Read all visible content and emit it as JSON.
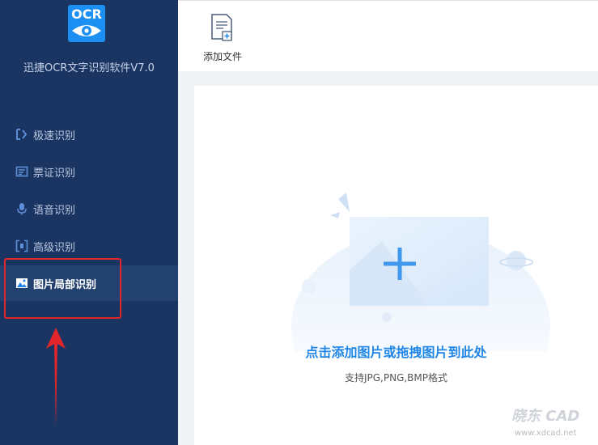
{
  "app": {
    "logo_text": "OCR",
    "title": "迅捷OCR文字识别软件V7.0"
  },
  "sidebar": {
    "items": [
      {
        "label": "极速识别",
        "icon": "fast-scan-icon"
      },
      {
        "label": "票证识别",
        "icon": "ticket-icon"
      },
      {
        "label": "语音识别",
        "icon": "microphone-icon"
      },
      {
        "label": "高级识别",
        "icon": "advanced-scan-icon"
      },
      {
        "label": "图片局部识别",
        "icon": "image-crop-icon",
        "active": true
      }
    ]
  },
  "toolbar": {
    "add_file_label": "添加文件"
  },
  "drop_area": {
    "title": "点击添加图片或拖拽图片到此处",
    "subtitle": "支持JPG,PNG,BMP格式"
  },
  "watermark": {
    "top": "晓东 CAD",
    "bottom": "www.xdcad.net"
  },
  "colors": {
    "sidebar_bg": "#1b3563",
    "active_bg": "#24426f",
    "accent": "#1f86e8",
    "annotation_red": "#e3262a"
  }
}
